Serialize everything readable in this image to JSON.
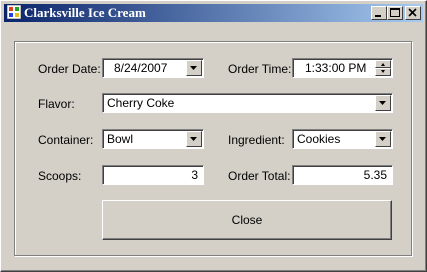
{
  "window": {
    "title": "Clarksville Ice Cream",
    "titlebar_colors": [
      "#0a246a",
      "#a6caf0"
    ]
  },
  "form": {
    "order_date": {
      "label": "Order Date:",
      "value": "8/24/2007"
    },
    "order_time": {
      "label": "Order Time:",
      "value": "1:33:00 PM"
    },
    "flavor": {
      "label": "Flavor:",
      "value": "Cherry Coke"
    },
    "container": {
      "label": "Container:",
      "value": "Bowl"
    },
    "ingredient": {
      "label": "Ingredient:",
      "value": "Cookies"
    },
    "scoops": {
      "label": "Scoops:",
      "value": "3"
    },
    "order_total": {
      "label": "Order Total:",
      "value": "5.35"
    }
  },
  "buttons": {
    "close_label": "Close"
  },
  "icons": {
    "app": "app-icon",
    "minimize": "minimize-icon",
    "maximize": "maximize-icon",
    "close": "close-icon",
    "dropdown": "chevron-down-icon",
    "spin_up": "spin-up-icon",
    "spin_down": "spin-down-icon"
  }
}
